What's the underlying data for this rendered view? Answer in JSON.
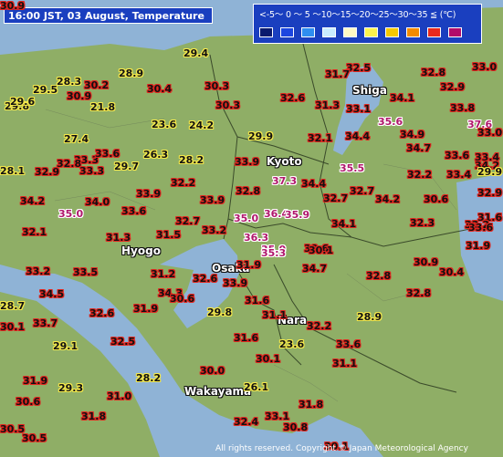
{
  "title": "16:00 JST, 03 August, Temperature",
  "legend": {
    "text": "<-5～ 0 ～ 5 ～10～15～20～25～30～35 ≦ (℃)",
    "colors": [
      "#0a1a6e",
      "#1c46e0",
      "#2f8ef0",
      "#c9ecff",
      "#fff9c4",
      "#fdf34d",
      "#f5c800",
      "#f28b00",
      "#e8291c",
      "#b20c6a"
    ]
  },
  "places": {
    "shiga": "Shiga",
    "kyoto": "Kyoto",
    "hyogo": "Hyogo",
    "osaka": "Osaka",
    "nara": "Nara",
    "wakayama": "Wakayama"
  },
  "temperatures": [
    "29.4",
    "32.5",
    "33.0",
    "28.9",
    "31.7",
    "32.8",
    "29.5",
    "28.3",
    "30.2",
    "30.4",
    "30.3",
    "32.6",
    "32.9",
    "29.8",
    "29.6",
    "30.9",
    "21.8",
    "30.3",
    "31.3",
    "33.1",
    "34.1",
    "33.8",
    "35.6",
    "37.6",
    "27.4",
    "23.6",
    "24.2",
    "29.9",
    "32.1",
    "34.4",
    "34.9",
    "33.0",
    "34.7",
    "26.3",
    "28.2",
    "33.9",
    "33.6",
    "33.4",
    "33.3",
    "33.6",
    "28.1",
    "32.9",
    "32.8",
    "33.3",
    "29.7",
    "37.3",
    "35.5",
    "32.2",
    "33.4",
    "34.2",
    "32.2",
    "34.4",
    "30.6",
    "32.9",
    "33.9",
    "32.8",
    "32.7",
    "32.7",
    "34.2",
    "31.6",
    "34.2",
    "34.0",
    "35.0",
    "36.4",
    "33.9",
    "35.0",
    "35.9",
    "32.3",
    "33.2",
    "33.6",
    "31.3",
    "31.5",
    "32.7",
    "33.2",
    "34.1",
    "30.6",
    "32.1",
    "36.3",
    "29.7",
    "35.0",
    "35.3",
    "30.1",
    "31.9",
    "30.9",
    "33.2",
    "33.5",
    "31.2",
    "31.9",
    "34.7",
    "30.4",
    "32.6",
    "33.9",
    "32.8",
    "28.7",
    "34.5",
    "34.3",
    "30.6",
    "29.8",
    "31.6",
    "32.8",
    "30.1",
    "33.7",
    "32.6",
    "31.9",
    "31.1",
    "28.9",
    "29.1",
    "32.5",
    "32.2",
    "31.6",
    "23.6",
    "33.6",
    "30.0",
    "30.1",
    "31.1",
    "31.9",
    "29.3",
    "28.2",
    "26.1",
    "30.6",
    "31.0",
    "31.8",
    "33.1",
    "31.8",
    "32.4",
    "30.8",
    "30.5",
    "30.5",
    "29.9",
    "30.1",
    "33.6",
    "33.6",
    "30.9"
  ],
  "copyright": "All rights reserved. Copyright © Japan Meteorological Agency"
}
